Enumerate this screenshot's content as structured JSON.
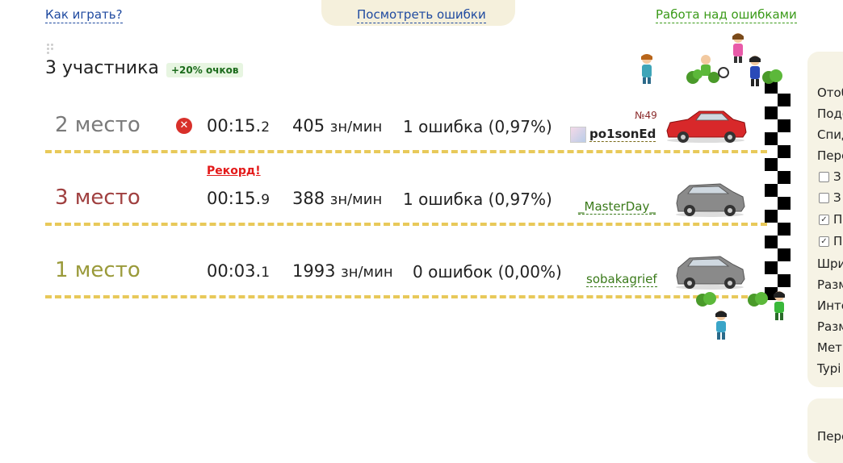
{
  "top_links": {
    "how_to_play": "Как играть?",
    "view_errors": "Посмотреть ошибки",
    "work_on_errors": "Работа над ошибками"
  },
  "header": {
    "participants": "3 участника",
    "bonus": "+20% очков"
  },
  "record_label": "Рекорд!",
  "rows": [
    {
      "place": "2 место",
      "place_color": "#7a7a7a",
      "time_main": "00:15.",
      "time_ms": "2",
      "speed": "405",
      "speed_unit": "зн/мин",
      "errors": "1 ошибка (0,97%)",
      "player": "po1sonEd",
      "player_num": "№49",
      "player_color": "#7a6a1a",
      "car_color": "#d8282a"
    },
    {
      "place": "3 место",
      "place_color": "#a04040",
      "time_main": "00:15.",
      "time_ms": "9",
      "speed": "388",
      "speed_unit": "зн/мин",
      "errors": "1 ошибка (0,97%)",
      "player": "_MasterDay_",
      "player_color": "#3a7a1a",
      "car_color": "#8a8a8a"
    },
    {
      "place": "1 место",
      "place_color": "#9a9a3a",
      "time_main": "00:03.",
      "time_ms": "1",
      "speed": "1993",
      "speed_unit": "зн/мин",
      "errors": "0 ошибок (0,00%)",
      "player": "sobakagrief",
      "player_color": "#3a7a1a",
      "car_color": "#8a8a8a"
    }
  ],
  "side_panel": {
    "items": [
      "Отоб",
      "Подо",
      "Спид",
      "Пере",
      "З",
      "З",
      "П",
      "П",
      "Шри",
      "Разм",
      "Инте",
      "Разм",
      "Метр",
      "Typi"
    ],
    "checkbox_states": [
      false,
      false,
      true,
      true
    ],
    "bottom_item": "Пере"
  }
}
